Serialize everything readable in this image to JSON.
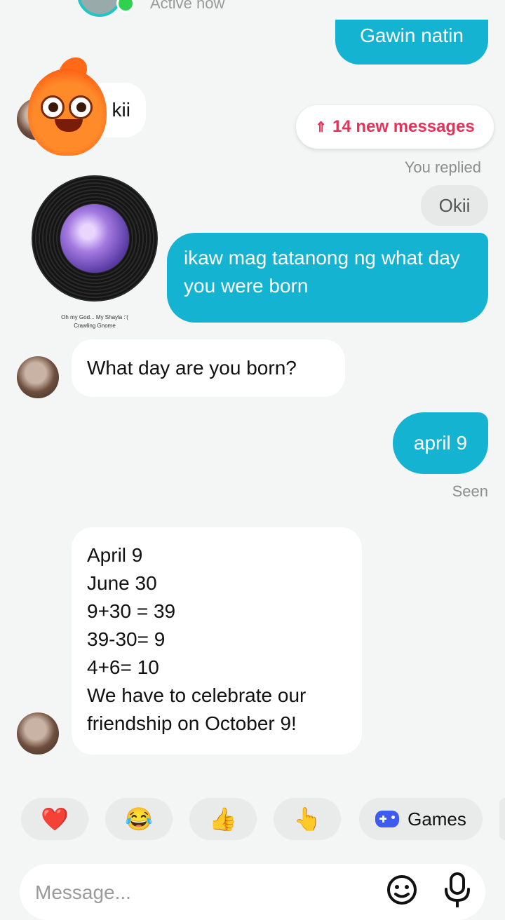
{
  "header": {
    "status": "Active now"
  },
  "messages": {
    "m1_out": "Gawin natin",
    "m2_in_partial": "kii",
    "new_messages_pill": "14 new messages",
    "replied_label": "You replied",
    "quoted_reply": "Okii",
    "m3_out": "ikaw mag tatanong ng what day you were born",
    "sticker_caption_line1": "Oh my God... My Shayla :'(",
    "sticker_caption_line2": "Crawling Gnome",
    "m4_in": "What day are you born?",
    "m5_out": "april 9",
    "seen_label": "Seen",
    "m6_in_lines": [
      "April 9",
      "June 30",
      "9+30 = 39",
      "39-30= 9",
      "4+6= 10",
      "We have to celebrate our",
      "friendship on October 9!"
    ]
  },
  "reactions": {
    "heart": "❤️",
    "laugh": "😂",
    "thumbs": "👍",
    "point": "👆",
    "games_label": "Games"
  },
  "composer": {
    "placeholder": "Message..."
  },
  "colors": {
    "accent": "#14b3d1",
    "alert": "#e8305a",
    "online": "#2fd14f"
  }
}
